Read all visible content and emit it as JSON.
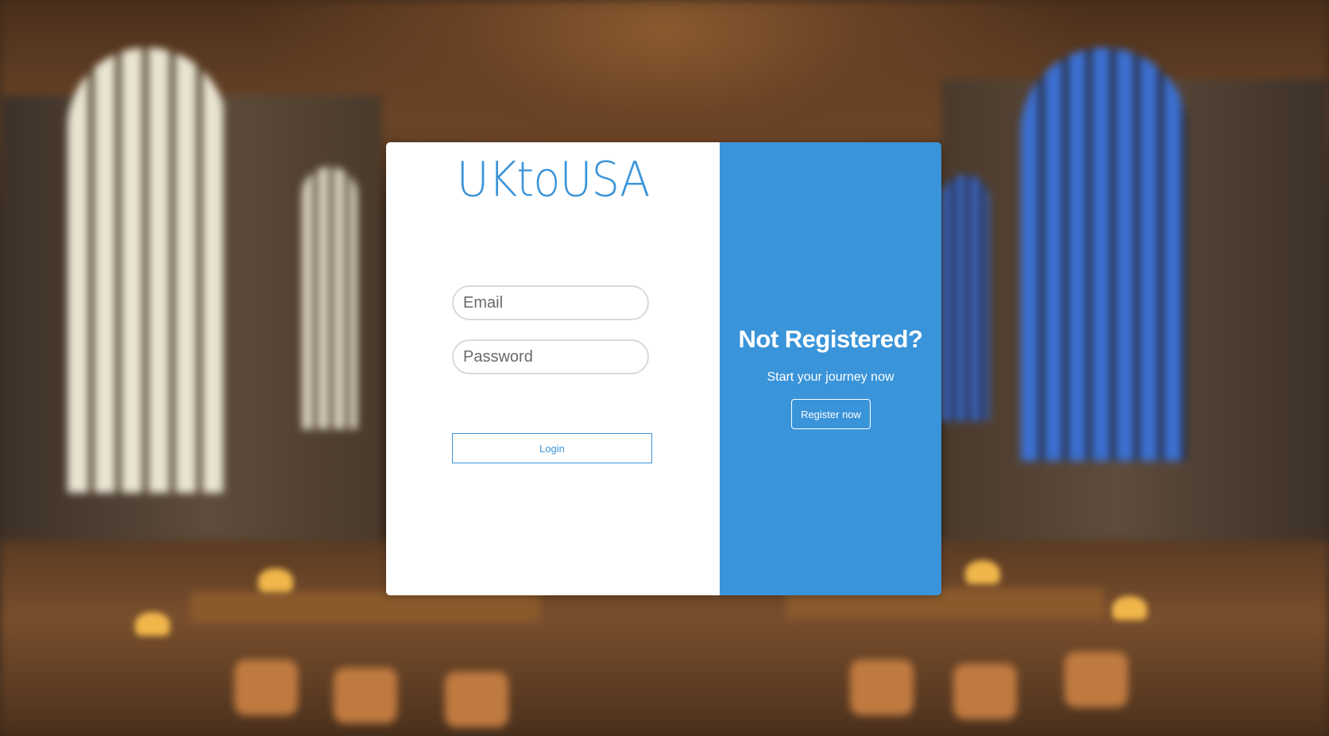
{
  "brand": {
    "name": "UKtoUSA",
    "color": "#3a94d9"
  },
  "login_form": {
    "email_placeholder": "Email",
    "password_placeholder": "Password",
    "login_label": "Login"
  },
  "register_panel": {
    "title": "Not Registered?",
    "subtitle": "Start your journey now",
    "register_label": "Register now",
    "background_color": "#3a94d9"
  },
  "background": {
    "description_colors": [
      "#3b2a1c",
      "#e9e4d2",
      "#3b6fd0",
      "#f0b64a"
    ]
  }
}
